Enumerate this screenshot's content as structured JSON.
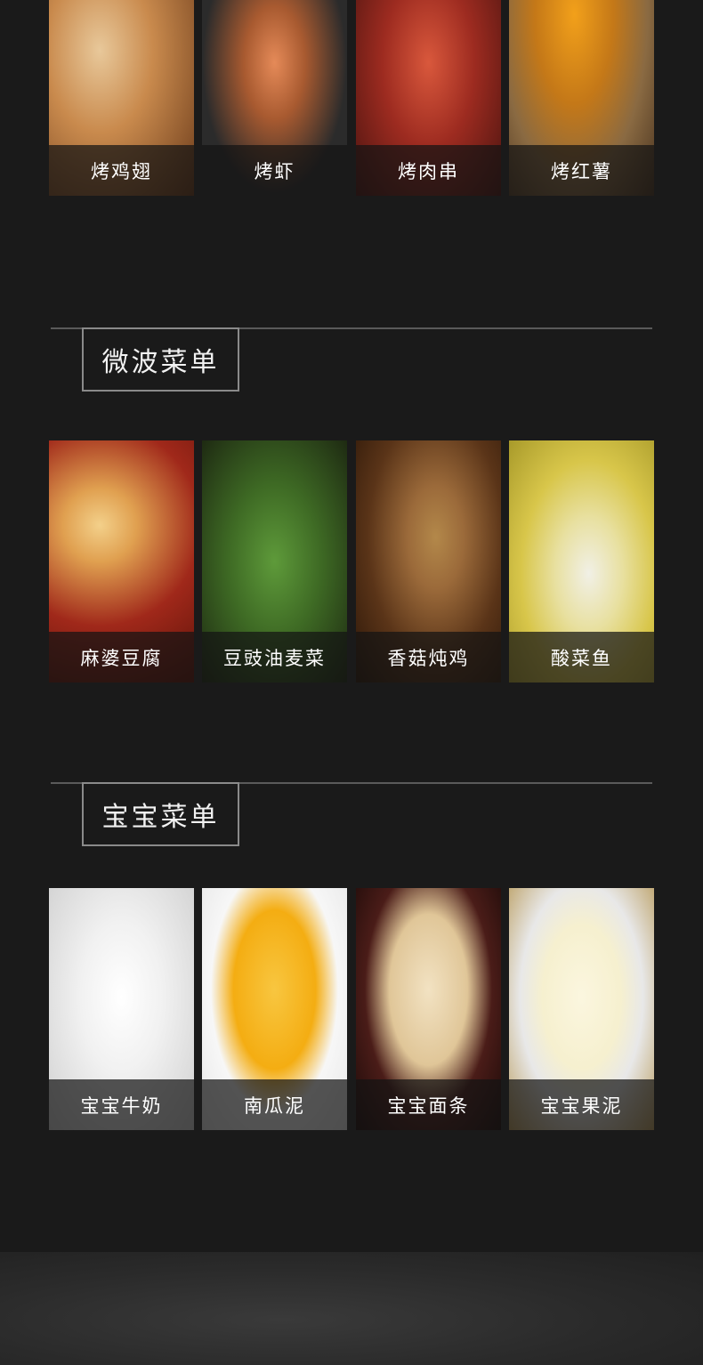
{
  "rows": [
    {
      "items": [
        {
          "label": "烤鸡翅",
          "bg": "#c98a4d",
          "accent": "#e8c89a"
        },
        {
          "label": "烤虾",
          "bg": "#2b2b2b",
          "accent": "#e58a58"
        },
        {
          "label": "烤肉串",
          "bg": "#9d2b20",
          "accent": "#d9583c"
        },
        {
          "label": "烤红薯",
          "bg": "#8a6a42",
          "accent": "#f2a01a"
        }
      ]
    },
    {
      "items": [
        {
          "label": "麻婆豆腐",
          "bg": "#a0281a",
          "accent": "#f3d08a"
        },
        {
          "label": "豆豉油麦菜",
          "bg": "#2f4a1e",
          "accent": "#5e9a3a"
        },
        {
          "label": "香菇炖鸡",
          "bg": "#5a3418",
          "accent": "#9b6a3a"
        },
        {
          "label": "酸菜鱼",
          "bg": "#d8c64a",
          "accent": "#f1f0e6"
        }
      ]
    },
    {
      "items": [
        {
          "label": "宝宝牛奶",
          "bg": "#e9e9e9",
          "accent": "#ffffff"
        },
        {
          "label": "南瓜泥",
          "bg": "#f7f7f7",
          "accent": "#f4ad12"
        },
        {
          "label": "宝宝面条",
          "bg": "#2a1614",
          "accent": "#f2e2c2"
        },
        {
          "label": "宝宝果泥",
          "bg": "#b89a5a",
          "accent": "#f6f0cf"
        }
      ]
    }
  ],
  "sections": [
    {
      "title": "微波菜单"
    },
    {
      "title": "宝宝菜单"
    }
  ]
}
